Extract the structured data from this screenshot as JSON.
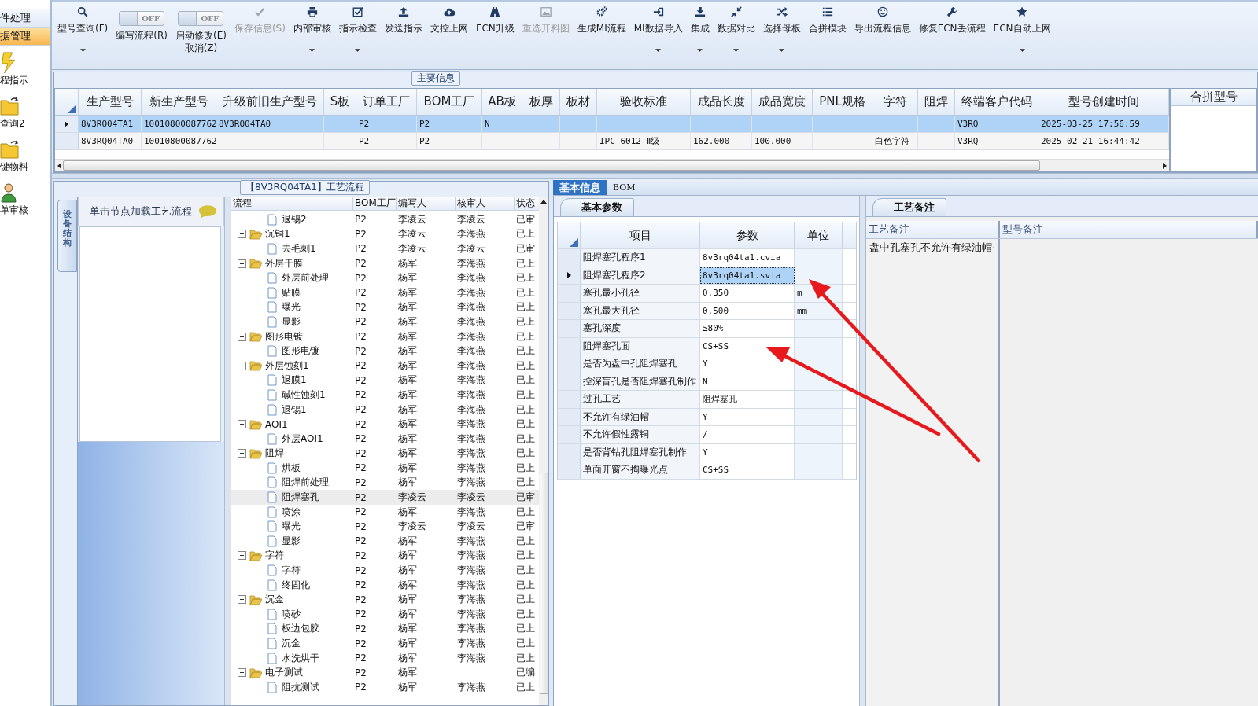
{
  "sidebar": {
    "items": [
      {
        "kind": "header",
        "label": "件处理",
        "selected": false
      },
      {
        "kind": "header",
        "label": "据管理",
        "selected": true
      },
      {
        "kind": "launcher",
        "label": "程指示",
        "selected": false
      },
      {
        "kind": "launcher",
        "label": "查询2",
        "selected": false
      },
      {
        "kind": "launcher",
        "label": "键物料",
        "selected": false
      },
      {
        "kind": "launcher",
        "label": "单审核",
        "selected": false
      }
    ]
  },
  "toolbar": {
    "items": [
      {
        "kind": "button",
        "label": "型号查询(F)",
        "dropdown": true,
        "disabled": false
      },
      {
        "kind": "toggle",
        "switch": "OFF",
        "on": false,
        "label": "编写流程(R)",
        "dropdown": false,
        "disabled": false
      },
      {
        "kind": "toggle",
        "switch": "OFF",
        "on": false,
        "label": "启动修改(E)",
        "sublabel": "取消(Z)",
        "dropdown": false,
        "disabled": false
      },
      {
        "kind": "button",
        "label": "保存信息(S)",
        "dropdown": false,
        "disabled": true
      },
      {
        "kind": "button",
        "label": "内部审核",
        "dropdown": true,
        "disabled": false
      },
      {
        "kind": "button",
        "label": "指示检查",
        "dropdown": true,
        "disabled": false
      },
      {
        "kind": "button",
        "label": "发送指示",
        "dropdown": false,
        "disabled": false
      },
      {
        "kind": "button",
        "label": "文控上网",
        "dropdown": false,
        "disabled": false
      },
      {
        "kind": "button",
        "label": "ECN升级",
        "dropdown": false,
        "disabled": false
      },
      {
        "kind": "button",
        "label": "重选开料图",
        "dropdown": false,
        "disabled": true
      },
      {
        "kind": "button",
        "label": "生成MI流程",
        "dropdown": false,
        "disabled": false
      },
      {
        "kind": "button",
        "label": "MI数据导入",
        "dropdown": true,
        "disabled": false
      },
      {
        "kind": "button",
        "label": "集成",
        "dropdown": true,
        "disabled": false
      },
      {
        "kind": "button",
        "label": "数据对比",
        "dropdown": true,
        "disabled": false
      },
      {
        "kind": "button",
        "label": "选择母板",
        "dropdown": true,
        "disabled": false
      },
      {
        "kind": "button",
        "label": "合拼模块",
        "dropdown": false,
        "disabled": false
      },
      {
        "kind": "button",
        "label": "导出流程信息",
        "dropdown": false,
        "disabled": false
      },
      {
        "kind": "button",
        "label": "修复ECN丢流程",
        "dropdown": false,
        "disabled": false
      },
      {
        "kind": "button",
        "label": "ECN自动上网",
        "dropdown": true,
        "disabled": false
      }
    ]
  },
  "main_info": {
    "title": "主要信息",
    "columns": [
      "生产型号",
      "新生产型号",
      "升级前旧生产型号",
      "S板",
      "订单工厂",
      "BOM工厂",
      "AB板",
      "板厚",
      "板材",
      "验收标准",
      "成品长度",
      "成品宽度",
      "PNL规格",
      "字符",
      "阻焊",
      "终端客户代码",
      "型号创建时间"
    ],
    "rows": [
      {
        "selected": true,
        "cells": [
          "8V3RQ04TA1",
          "10010800087762",
          "8V3RQ04TA0",
          null,
          "P2",
          "P2",
          "N",
          null,
          null,
          null,
          null,
          null,
          null,
          null,
          null,
          "V3RQ",
          "2025-03-25 17:56:59"
        ]
      },
      {
        "selected": false,
        "cells": [
          "8V3RQ04TA0",
          "10010800087762",
          null,
          null,
          "P2",
          "P2",
          null,
          null,
          null,
          "IPC-6012 Ⅱ级",
          "162.000",
          "100.000",
          null,
          "白色字符",
          null,
          "V3RQ",
          "2025-02-21 16:44:42"
        ]
      }
    ],
    "side_column": "合拼型号"
  },
  "process": {
    "title": "【8V3RQ04TA1】工艺流程",
    "side_tab": "设备结构",
    "hint": "单击节点加载工艺流程",
    "columns": [
      "流程",
      "BOM工厂",
      "编写人",
      "核审人",
      "状态"
    ],
    "tree": [
      {
        "children": [
          {
            "label": "退锡2",
            "bom": "P2",
            "author": "李凌云",
            "reviewer": "李凌云",
            "status": "已审",
            "selected": false
          }
        ]
      },
      {
        "label": "沉铜1",
        "bom": "P2",
        "author": "李凌云",
        "reviewer": "李海燕",
        "status": "已上",
        "selected": false,
        "expanded": true,
        "children": [
          {
            "label": "去毛刺1",
            "bom": "P2",
            "author": "李凌云",
            "reviewer": "李凌云",
            "status": "已审",
            "selected": false
          }
        ]
      },
      {
        "label": "外层干膜",
        "bom": "P2",
        "author": "杨军",
        "reviewer": "李海燕",
        "status": "已上",
        "selected": false,
        "expanded": true,
        "children": [
          {
            "label": "外层前处理",
            "bom": "P2",
            "author": "杨军",
            "reviewer": "李海燕",
            "status": "已上",
            "selected": false
          },
          {
            "label": "贴膜",
            "bom": "P2",
            "author": "杨军",
            "reviewer": "李海燕",
            "status": "已上",
            "selected": false
          },
          {
            "label": "曝光",
            "bom": "P2",
            "author": "杨军",
            "reviewer": "李海燕",
            "status": "已上",
            "selected": false
          },
          {
            "label": "显影",
            "bom": "P2",
            "author": "杨军",
            "reviewer": "李海燕",
            "status": "已上",
            "selected": false
          }
        ]
      },
      {
        "label": "图形电镀",
        "bom": "P2",
        "author": "杨军",
        "reviewer": "李海燕",
        "status": "已上",
        "selected": false,
        "expanded": true,
        "children": [
          {
            "label": "图形电镀",
            "bom": "P2",
            "author": "杨军",
            "reviewer": "李海燕",
            "status": "已上",
            "selected": false
          }
        ]
      },
      {
        "label": "外层蚀刻1",
        "bom": "P2",
        "author": "杨军",
        "reviewer": "李海燕",
        "status": "已上",
        "selected": false,
        "expanded": true,
        "children": [
          {
            "label": "退膜1",
            "bom": "P2",
            "author": "杨军",
            "reviewer": "李海燕",
            "status": "已上",
            "selected": false
          },
          {
            "label": "碱性蚀刻1",
            "bom": "P2",
            "author": "杨军",
            "reviewer": "李海燕",
            "status": "已上",
            "selected": false
          },
          {
            "label": "退锡1",
            "bom": "P2",
            "author": "杨军",
            "reviewer": "李海燕",
            "status": "已上",
            "selected": false
          }
        ]
      },
      {
        "label": "AOI1",
        "bom": "P2",
        "author": "杨军",
        "reviewer": "李海燕",
        "status": "已上",
        "selected": false,
        "expanded": true,
        "children": [
          {
            "label": "外层AOI1",
            "bom": "P2",
            "author": "杨军",
            "reviewer": "李海燕",
            "status": "已上",
            "selected": false
          }
        ]
      },
      {
        "label": "阻焊",
        "bom": "P2",
        "author": "杨军",
        "reviewer": "李海燕",
        "status": "已上",
        "selected": false,
        "expanded": true,
        "children": [
          {
            "label": "烘板",
            "bom": "P2",
            "author": "杨军",
            "reviewer": "李海燕",
            "status": "已上",
            "selected": false
          },
          {
            "label": "阻焊前处理",
            "bom": "P2",
            "author": "杨军",
            "reviewer": "李海燕",
            "status": "已上",
            "selected": false
          },
          {
            "label": "阻焊塞孔",
            "bom": "P2",
            "author": "李凌云",
            "reviewer": "李凌云",
            "status": "已审",
            "selected": true
          },
          {
            "label": "喷涂",
            "bom": "P2",
            "author": "杨军",
            "reviewer": "李海燕",
            "status": "已上",
            "selected": false
          },
          {
            "label": "曝光",
            "bom": "P2",
            "author": "李凌云",
            "reviewer": "李凌云",
            "status": "已审",
            "selected": false
          },
          {
            "label": "显影",
            "bom": "P2",
            "author": "杨军",
            "reviewer": "李海燕",
            "status": "已上",
            "selected": false
          }
        ]
      },
      {
        "label": "字符",
        "bom": "P2",
        "author": "杨军",
        "reviewer": "李海燕",
        "status": "已上",
        "selected": false,
        "expanded": true,
        "children": [
          {
            "label": "字符",
            "bom": "P2",
            "author": "杨军",
            "reviewer": "李海燕",
            "status": "已上",
            "selected": false
          },
          {
            "label": "终固化",
            "bom": "P2",
            "author": "杨军",
            "reviewer": "李海燕",
            "status": "已上",
            "selected": false
          }
        ]
      },
      {
        "label": "沉金",
        "bom": "P2",
        "author": "杨军",
        "reviewer": "李海燕",
        "status": "已上",
        "selected": false,
        "expanded": true,
        "children": [
          {
            "label": "喷砂",
            "bom": "P2",
            "author": "杨军",
            "reviewer": "李海燕",
            "status": "已上",
            "selected": false
          },
          {
            "label": "板边包胶",
            "bom": "P2",
            "author": "杨军",
            "reviewer": "李海燕",
            "status": "已上",
            "selected": false
          },
          {
            "label": "沉金",
            "bom": "P2",
            "author": "杨军",
            "reviewer": "李海燕",
            "status": "已上",
            "selected": false
          },
          {
            "label": "水洗烘干",
            "bom": "P2",
            "author": "杨军",
            "reviewer": "李海燕",
            "status": "已上",
            "selected": false
          }
        ]
      },
      {
        "label": "电子测试",
        "bom": "P2",
        "author": "杨军",
        "status": "已编",
        "selected": false,
        "expanded": true,
        "children": [
          {
            "label": "阻抗测试",
            "bom": "P2",
            "author": "杨军",
            "reviewer": "李海燕",
            "status": "已上",
            "selected": false
          }
        ]
      }
    ]
  },
  "details": {
    "tabs": [
      {
        "label": "基本信息",
        "selected": true
      },
      {
        "label": "BOM",
        "selected": false
      }
    ],
    "subtab": "基本参数",
    "columns": [
      "项目",
      "参数",
      "单位"
    ],
    "rows": [
      {
        "item": "阻焊塞孔程序1",
        "value": "8v3rq04ta1.cvia",
        "selected": false
      },
      {
        "item": "阻焊塞孔程序2",
        "value": "8v3rq04ta1.svia",
        "selected": true
      },
      {
        "item": "塞孔最小孔径",
        "value": "0.350",
        "unit": "m",
        "selected": false
      },
      {
        "item": "塞孔最大孔径",
        "value": "0.500",
        "unit": "mm",
        "selected": false
      },
      {
        "item": "塞孔深度",
        "value": "≥80%",
        "selected": false
      },
      {
        "item": "阻焊塞孔面",
        "value": "CS+SS",
        "selected": false
      },
      {
        "item": "是否为盘中孔阻焊塞孔",
        "value": "Y",
        "selected": false
      },
      {
        "item": "控深盲孔是否阻焊塞孔制作",
        "value": "N",
        "selected": false
      },
      {
        "item": "过孔工艺",
        "value": "阻焊塞孔",
        "selected": false
      },
      {
        "item": "不允许有绿油帽",
        "value": "Y",
        "selected": false
      },
      {
        "item": "不允许假性露铜",
        "value": "/",
        "selected": false
      },
      {
        "item": "是否背钻孔阻焊塞孔制作",
        "value": "Y",
        "selected": false
      },
      {
        "item": "单面开窗不掏曝光点",
        "value": "CS+SS",
        "selected": false
      }
    ]
  },
  "notes": {
    "tab": "工艺备注",
    "columns": [
      "工艺备注",
      "型号备注"
    ],
    "process_note": "盘中孔塞孔不允许有绿油帽"
  }
}
